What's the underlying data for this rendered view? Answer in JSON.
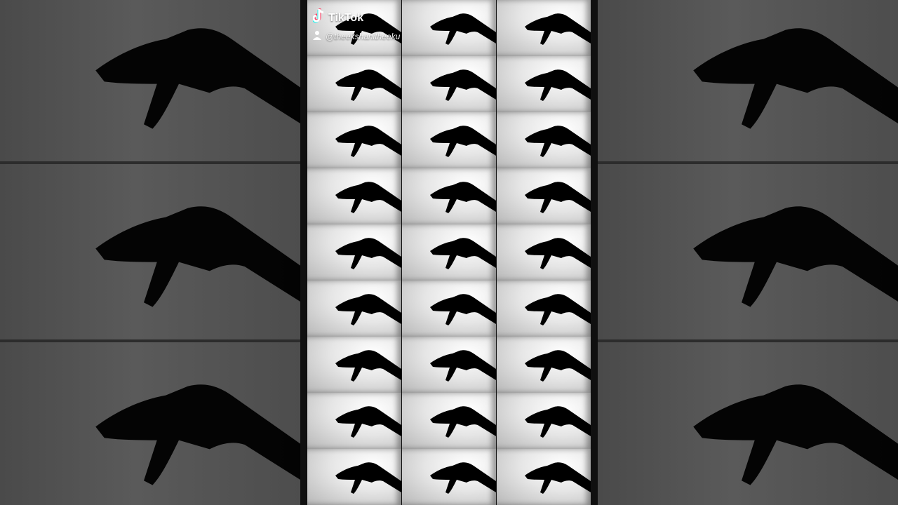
{
  "overlay": {
    "brand": "TikTok",
    "handle": "@theekshanitheeku"
  },
  "icons": {
    "brand_icon": "tiktok-note-icon",
    "user_icon": "user-icon"
  },
  "colors": {
    "background": "#1e1e1e",
    "silhouette": "#000000",
    "tile_light": "#ffffff"
  }
}
